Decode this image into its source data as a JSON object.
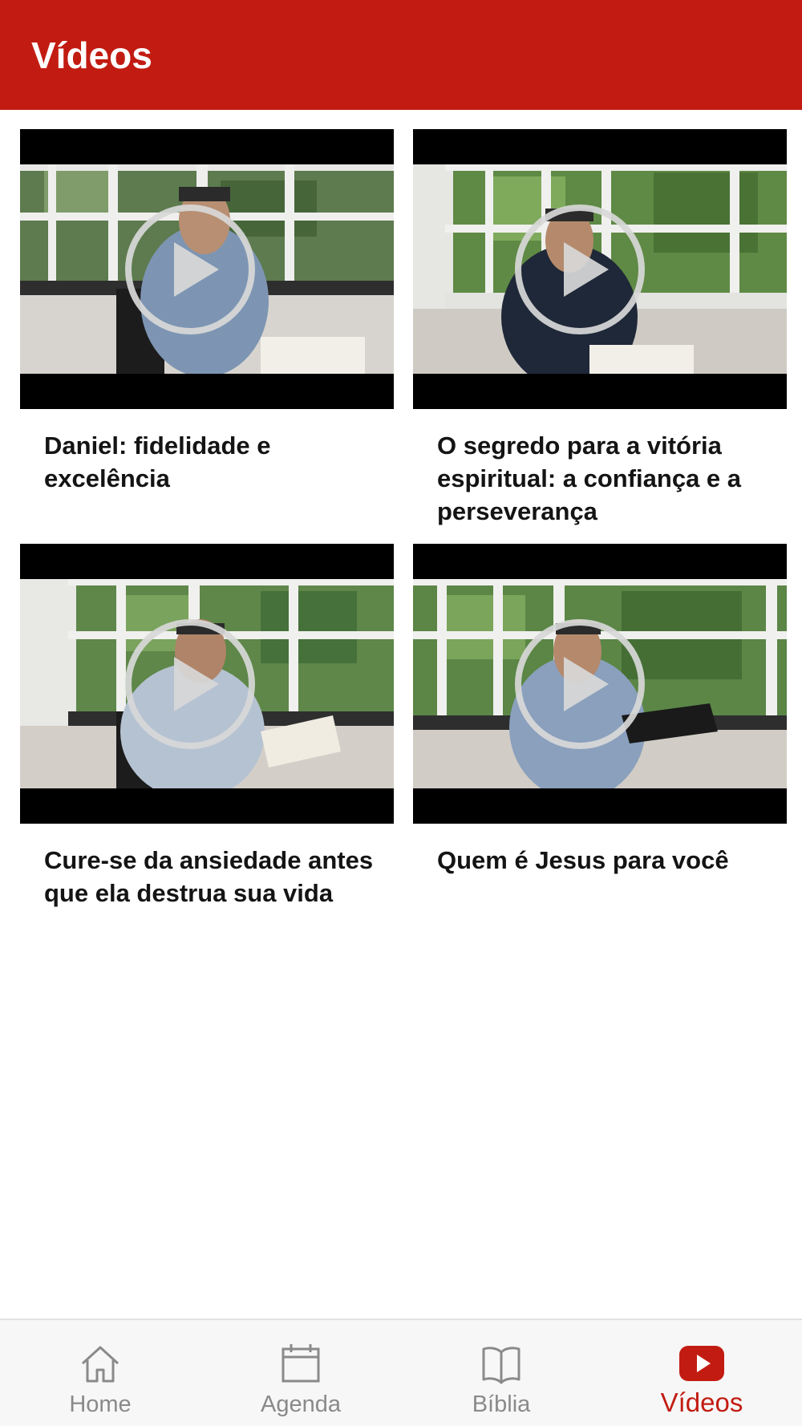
{
  "header": {
    "title": "Vídeos"
  },
  "colors": {
    "brand": "#c21c12",
    "tab_inactive": "#8a8a8a",
    "text": "#141414"
  },
  "videos": [
    {
      "title": "Daniel: fidelidade e excelência",
      "thumbnail_icon": "play-icon"
    },
    {
      "title": "O segredo para a vitória espiritual: a confiança e a perseverança",
      "thumbnail_icon": "play-icon"
    },
    {
      "title": "Cure-se da ansiedade antes que ela destrua sua vida",
      "thumbnail_icon": "play-icon"
    },
    {
      "title": "Quem é Jesus para você",
      "thumbnail_icon": "play-icon"
    }
  ],
  "tabs": [
    {
      "label": "Home",
      "icon": "home-icon",
      "active": false
    },
    {
      "label": "Agenda",
      "icon": "calendar-icon",
      "active": false
    },
    {
      "label": "Bíblia",
      "icon": "book-icon",
      "active": false
    },
    {
      "label": "Vídeos",
      "icon": "youtube-icon",
      "active": true
    }
  ]
}
